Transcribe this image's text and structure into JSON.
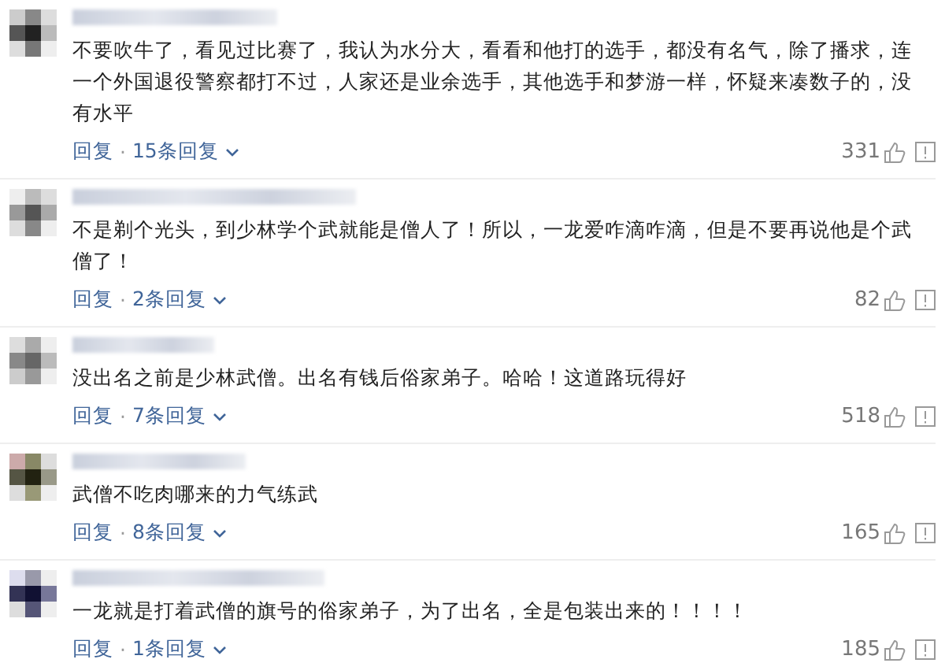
{
  "comments": [
    {
      "text": "不要吹牛了，看见过比赛了，我认为水分大，看看和他打的选手，都没有名气，除了播求，连一个外国退役警察都打不过，人家还是业余选手，其他选手和梦游一样，怀疑来凑数子的，没有水平",
      "reply": "回复",
      "separator": "·",
      "replies": "15条回复",
      "likes": "331"
    },
    {
      "text": "不是剃个光头，到少林学个武就能是僧人了！所以，一龙爱咋滴咋滴，但是不要再说他是个武僧了！",
      "reply": "回复",
      "separator": "·",
      "replies": "2条回复",
      "likes": "82"
    },
    {
      "text": "没出名之前是少林武僧。出名有钱后俗家弟子。哈哈！这道路玩得好",
      "reply": "回复",
      "separator": "·",
      "replies": "7条回复",
      "likes": "518"
    },
    {
      "text": "武僧不吃肉哪来的力气练武",
      "reply": "回复",
      "separator": "·",
      "replies": "8条回复",
      "likes": "165"
    },
    {
      "text": "一龙就是打着武僧的旗号的俗家弟子，为了出名，全是包装出来的！！！！",
      "reply": "回复",
      "separator": "·",
      "replies": "1条回复",
      "likes": "185"
    }
  ]
}
